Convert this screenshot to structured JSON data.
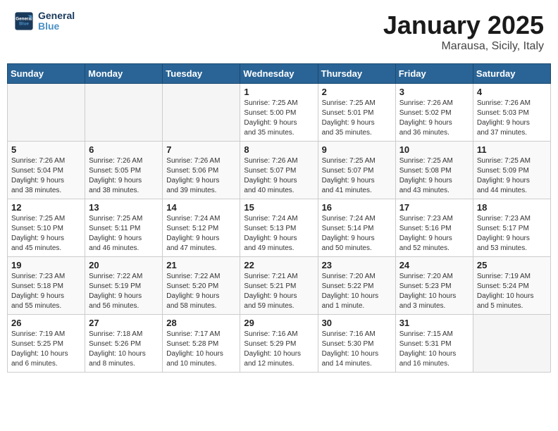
{
  "header": {
    "logo_line1": "General",
    "logo_line2": "Blue",
    "month": "January 2025",
    "location": "Marausa, Sicily, Italy"
  },
  "weekdays": [
    "Sunday",
    "Monday",
    "Tuesday",
    "Wednesday",
    "Thursday",
    "Friday",
    "Saturday"
  ],
  "weeks": [
    [
      {
        "day": "",
        "info": ""
      },
      {
        "day": "",
        "info": ""
      },
      {
        "day": "",
        "info": ""
      },
      {
        "day": "1",
        "info": "Sunrise: 7:25 AM\nSunset: 5:00 PM\nDaylight: 9 hours\nand 35 minutes."
      },
      {
        "day": "2",
        "info": "Sunrise: 7:25 AM\nSunset: 5:01 PM\nDaylight: 9 hours\nand 35 minutes."
      },
      {
        "day": "3",
        "info": "Sunrise: 7:26 AM\nSunset: 5:02 PM\nDaylight: 9 hours\nand 36 minutes."
      },
      {
        "day": "4",
        "info": "Sunrise: 7:26 AM\nSunset: 5:03 PM\nDaylight: 9 hours\nand 37 minutes."
      }
    ],
    [
      {
        "day": "5",
        "info": "Sunrise: 7:26 AM\nSunset: 5:04 PM\nDaylight: 9 hours\nand 38 minutes."
      },
      {
        "day": "6",
        "info": "Sunrise: 7:26 AM\nSunset: 5:05 PM\nDaylight: 9 hours\nand 38 minutes."
      },
      {
        "day": "7",
        "info": "Sunrise: 7:26 AM\nSunset: 5:06 PM\nDaylight: 9 hours\nand 39 minutes."
      },
      {
        "day": "8",
        "info": "Sunrise: 7:26 AM\nSunset: 5:07 PM\nDaylight: 9 hours\nand 40 minutes."
      },
      {
        "day": "9",
        "info": "Sunrise: 7:25 AM\nSunset: 5:07 PM\nDaylight: 9 hours\nand 41 minutes."
      },
      {
        "day": "10",
        "info": "Sunrise: 7:25 AM\nSunset: 5:08 PM\nDaylight: 9 hours\nand 43 minutes."
      },
      {
        "day": "11",
        "info": "Sunrise: 7:25 AM\nSunset: 5:09 PM\nDaylight: 9 hours\nand 44 minutes."
      }
    ],
    [
      {
        "day": "12",
        "info": "Sunrise: 7:25 AM\nSunset: 5:10 PM\nDaylight: 9 hours\nand 45 minutes."
      },
      {
        "day": "13",
        "info": "Sunrise: 7:25 AM\nSunset: 5:11 PM\nDaylight: 9 hours\nand 46 minutes."
      },
      {
        "day": "14",
        "info": "Sunrise: 7:24 AM\nSunset: 5:12 PM\nDaylight: 9 hours\nand 47 minutes."
      },
      {
        "day": "15",
        "info": "Sunrise: 7:24 AM\nSunset: 5:13 PM\nDaylight: 9 hours\nand 49 minutes."
      },
      {
        "day": "16",
        "info": "Sunrise: 7:24 AM\nSunset: 5:14 PM\nDaylight: 9 hours\nand 50 minutes."
      },
      {
        "day": "17",
        "info": "Sunrise: 7:23 AM\nSunset: 5:16 PM\nDaylight: 9 hours\nand 52 minutes."
      },
      {
        "day": "18",
        "info": "Sunrise: 7:23 AM\nSunset: 5:17 PM\nDaylight: 9 hours\nand 53 minutes."
      }
    ],
    [
      {
        "day": "19",
        "info": "Sunrise: 7:23 AM\nSunset: 5:18 PM\nDaylight: 9 hours\nand 55 minutes."
      },
      {
        "day": "20",
        "info": "Sunrise: 7:22 AM\nSunset: 5:19 PM\nDaylight: 9 hours\nand 56 minutes."
      },
      {
        "day": "21",
        "info": "Sunrise: 7:22 AM\nSunset: 5:20 PM\nDaylight: 9 hours\nand 58 minutes."
      },
      {
        "day": "22",
        "info": "Sunrise: 7:21 AM\nSunset: 5:21 PM\nDaylight: 9 hours\nand 59 minutes."
      },
      {
        "day": "23",
        "info": "Sunrise: 7:20 AM\nSunset: 5:22 PM\nDaylight: 10 hours\nand 1 minute."
      },
      {
        "day": "24",
        "info": "Sunrise: 7:20 AM\nSunset: 5:23 PM\nDaylight: 10 hours\nand 3 minutes."
      },
      {
        "day": "25",
        "info": "Sunrise: 7:19 AM\nSunset: 5:24 PM\nDaylight: 10 hours\nand 5 minutes."
      }
    ],
    [
      {
        "day": "26",
        "info": "Sunrise: 7:19 AM\nSunset: 5:25 PM\nDaylight: 10 hours\nand 6 minutes."
      },
      {
        "day": "27",
        "info": "Sunrise: 7:18 AM\nSunset: 5:26 PM\nDaylight: 10 hours\nand 8 minutes."
      },
      {
        "day": "28",
        "info": "Sunrise: 7:17 AM\nSunset: 5:28 PM\nDaylight: 10 hours\nand 10 minutes."
      },
      {
        "day": "29",
        "info": "Sunrise: 7:16 AM\nSunset: 5:29 PM\nDaylight: 10 hours\nand 12 minutes."
      },
      {
        "day": "30",
        "info": "Sunrise: 7:16 AM\nSunset: 5:30 PM\nDaylight: 10 hours\nand 14 minutes."
      },
      {
        "day": "31",
        "info": "Sunrise: 7:15 AM\nSunset: 5:31 PM\nDaylight: 10 hours\nand 16 minutes."
      },
      {
        "day": "",
        "info": ""
      }
    ]
  ]
}
